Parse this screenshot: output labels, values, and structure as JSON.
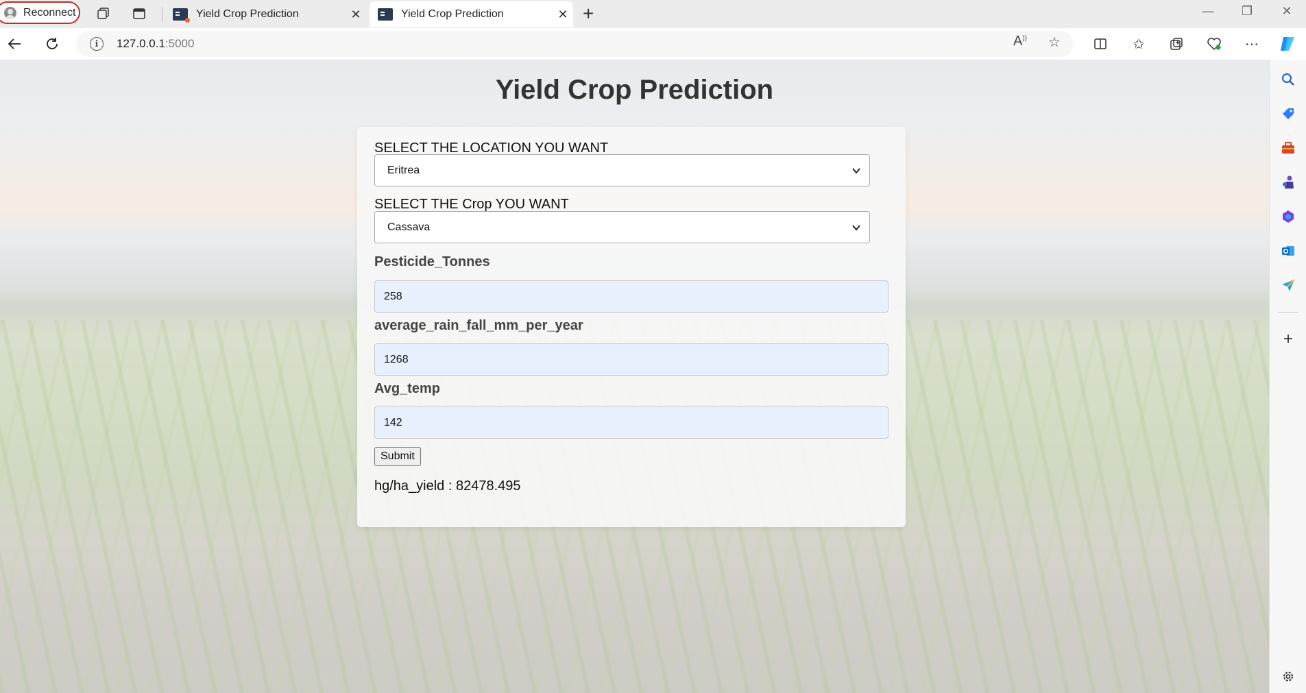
{
  "browser": {
    "reconnect_label": "Reconnect",
    "tabs": [
      {
        "title": "Yield Crop Prediction",
        "active": false
      },
      {
        "title": "Yield Crop Prediction",
        "active": true
      }
    ],
    "url_host": "127.0.0.1",
    "url_port": ":5000",
    "icons": {
      "new_tab": "plus-icon",
      "back": "back-arrow-icon",
      "refresh": "refresh-icon",
      "site_info": "info-icon",
      "read_aloud": "read-aloud-icon",
      "favorite": "star-icon",
      "split_screen": "split-screen-icon",
      "favorites": "favorites-icon",
      "collections": "collections-icon",
      "browser_essentials": "heart-pulse-icon",
      "more": "more-icon",
      "copilot": "copilot-icon"
    }
  },
  "sidebar": {
    "icons": [
      "search-icon",
      "shopping-tag-icon",
      "tools-icon",
      "games-icon",
      "office-icon",
      "outlook-icon",
      "send-icon",
      "add-icon",
      "settings-icon"
    ]
  },
  "page": {
    "title": "Yield Crop Prediction",
    "location_label": "SELECT THE LOCATION YOU WANT",
    "location_value": "Eritrea",
    "crop_label": "SELECT THE Crop YOU WANT",
    "crop_value": "Cassava",
    "pesticide_label": "Pesticide_Tonnes",
    "pesticide_value": "258",
    "rain_label": "average_rain_fall_mm_per_year",
    "rain_value": "1268",
    "temp_label": "Avg_temp",
    "temp_value": "142",
    "submit_label": "Submit",
    "result_text": "hg/ha_yield : 82478.495"
  },
  "colors": {
    "reconnect_border": "#c42b2b",
    "input_bg": "#e8f0fe",
    "title_color": "#333333",
    "copilot_accent": "#1f8ef1"
  }
}
